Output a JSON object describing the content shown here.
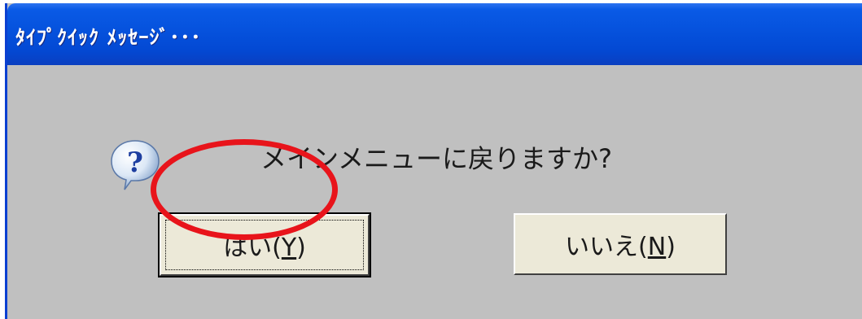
{
  "window": {
    "title": "ﾀｲﾌﾟｸｲｯｸ ﾒｯｾｰｼﾞ･･･"
  },
  "dialog": {
    "icon": "question-icon",
    "message": "メインメニューに戻りますか?"
  },
  "buttons": {
    "yes_label": "はい(",
    "yes_mnemonic": "Y",
    "yes_suffix": ")",
    "no_label": "いいえ(",
    "no_mnemonic": "N",
    "no_suffix": ")"
  },
  "annotation": {
    "color": "#e8141b"
  },
  "colors": {
    "titlebar": "#0653de",
    "dialog_bg": "#c0c0c0",
    "button_face": "#ece9d8"
  }
}
